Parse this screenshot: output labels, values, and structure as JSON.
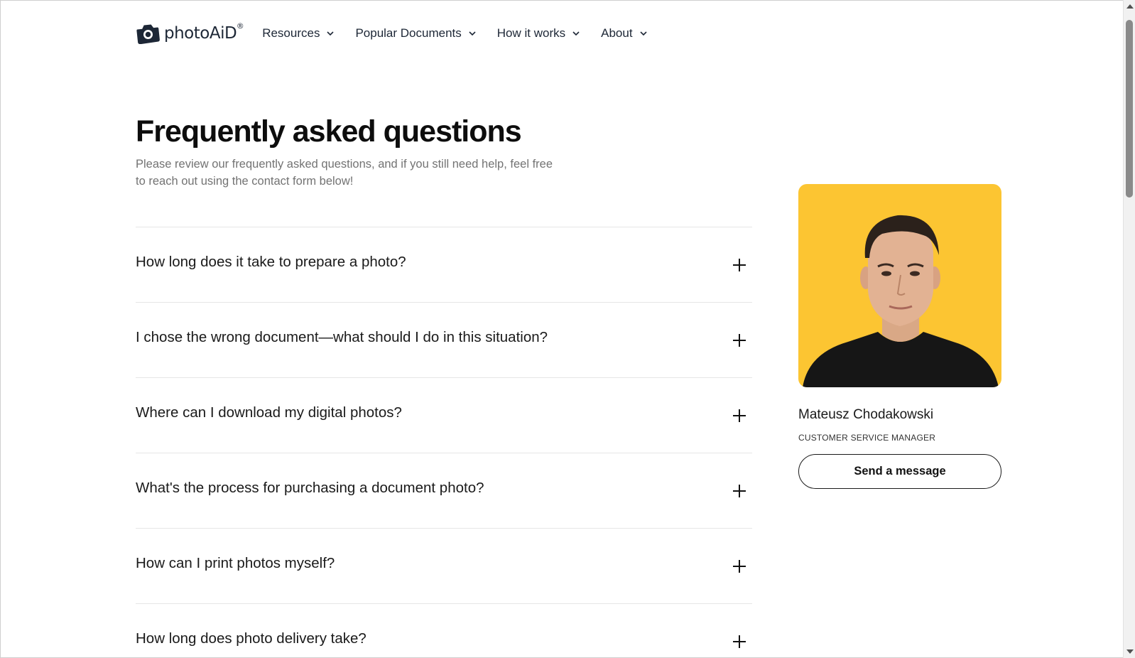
{
  "header": {
    "logo_text": "photoAiD",
    "logo_reg": "®",
    "nav": [
      {
        "label": "Resources"
      },
      {
        "label": "Popular Documents"
      },
      {
        "label": "How it works"
      },
      {
        "label": "About"
      }
    ]
  },
  "main": {
    "title": "Frequently asked questions",
    "subtitle": "Please review our frequently asked questions, and if you still need help, feel free to reach out using the contact form below!",
    "faq": [
      {
        "question": "How long does it take to prepare a photo?"
      },
      {
        "question": "I chose the wrong document—what should I do in this situation?"
      },
      {
        "question": "Where can I download my digital photos?"
      },
      {
        "question": "What's the process for purchasing a document photo?"
      },
      {
        "question": "How can I print photos myself?"
      },
      {
        "question": "How long does photo delivery take?"
      }
    ]
  },
  "contact": {
    "name": "Mateusz Chodakowski",
    "role": "CUSTOMER SERVICE MANAGER",
    "button": "Send a message"
  },
  "colors": {
    "photo_background": "#fcc532",
    "text_dark": "#1d2736",
    "subtitle_gray": "#737373"
  }
}
